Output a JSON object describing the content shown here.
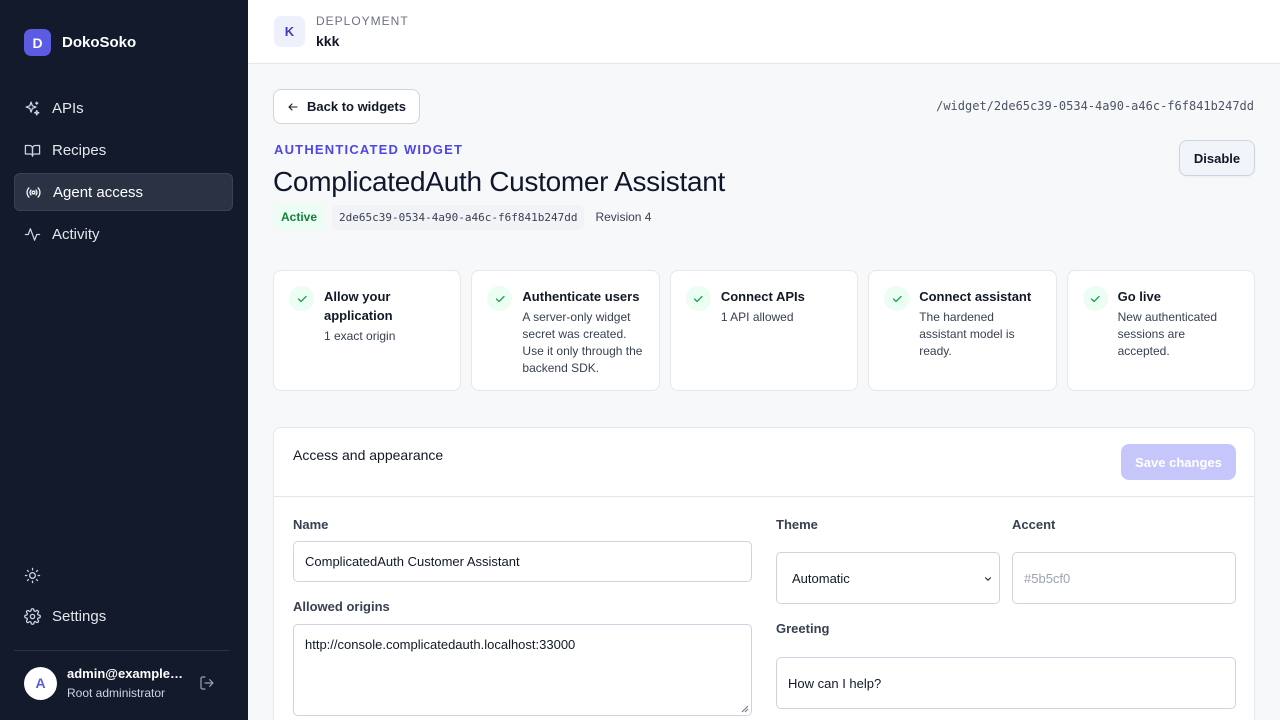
{
  "app": {
    "name": "DokoSoko",
    "logo_letter": "D"
  },
  "sidebar": {
    "items": [
      {
        "label": "APIs",
        "icon": "sparkle-icon"
      },
      {
        "label": "Recipes",
        "icon": "book-icon"
      },
      {
        "label": "Agent access",
        "icon": "broadcast-icon",
        "active": true
      },
      {
        "label": "Activity",
        "icon": "activity-icon"
      }
    ],
    "settings_label": "Settings",
    "user": {
      "initial": "A",
      "email": "admin@example.com",
      "role": "Root administrator"
    }
  },
  "topbar": {
    "avatar": "K",
    "label": "DEPLOYMENT",
    "name": "kkk"
  },
  "main": {
    "back_label": "Back to widgets",
    "path": "/widget/2de65c39-0534-4a90-a46c-f6f841b247dd",
    "eyebrow": "AUTHENTICATED WIDGET",
    "title": "ComplicatedAuth Customer Assistant",
    "disable_label": "Disable",
    "status": "Active",
    "widget_id": "2de65c39-0534-4a90-a46c-f6f841b247dd",
    "revision": "Revision 4"
  },
  "steps": [
    {
      "title": "Allow your application",
      "desc": "1 exact origin"
    },
    {
      "title": "Authenticate users",
      "desc": "A server-only widget secret was created. Use it only through the backend SDK."
    },
    {
      "title": "Connect APIs",
      "desc": "1 API allowed"
    },
    {
      "title": "Connect assistant",
      "desc": "The hardened assistant model is ready."
    },
    {
      "title": "Go live",
      "desc": "New authenticated sessions are accepted."
    }
  ],
  "form": {
    "title": "Access and appearance",
    "save_label": "Save changes",
    "name_label": "Name",
    "name_value": "ComplicatedAuth Customer Assistant",
    "origins_label": "Allowed origins",
    "origins_value": "http://console.complicatedauth.localhost:33000",
    "theme_label": "Theme",
    "theme_value": "Automatic",
    "accent_label": "Accent",
    "accent_placeholder": "#5b5cf0",
    "greeting_label": "Greeting",
    "greeting_value": "How can I help?"
  },
  "colors": {
    "brand": "#5b5ce2",
    "sidebar_bg": "#121a2b",
    "accent_text": "#4f46e5",
    "success": "#15803d"
  }
}
